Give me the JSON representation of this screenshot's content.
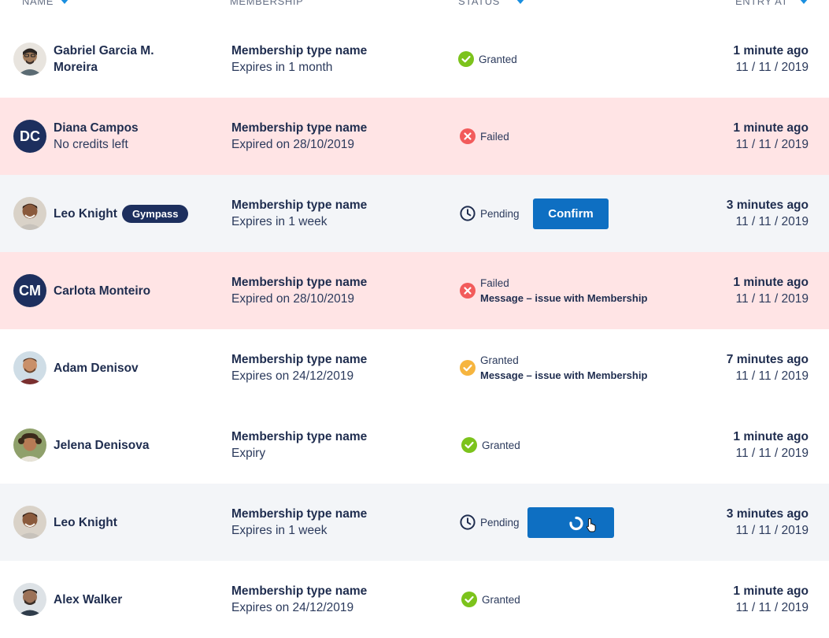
{
  "header": {
    "name": "NAME",
    "membership": "MEMBERSHIP",
    "status": "STATUS",
    "entry_at": "ENTRY AT"
  },
  "colors": {
    "granted": "#7cc31c",
    "failed": "#f25b5b",
    "warning": "#f6b53f",
    "primary_button": "#0e6fc2",
    "badge": "#1d2f5e",
    "failed_row_bg": "#ffe4e5",
    "alt_row_bg": "#f3f5f8"
  },
  "rows": [
    {
      "name_line1": "Gabriel Garcia M.",
      "name_line2": "Moreira",
      "membership": "Membership type name",
      "expiry": "Expires in 1 month",
      "status": "Granted",
      "entry": "1 minute ago",
      "date": "11 / 11 / 2019"
    },
    {
      "initials": "DC",
      "name": "Diana Campos",
      "sub": "No credits left",
      "membership": "Membership type name",
      "expiry": "Expired on 28/10/2019",
      "status": "Failed",
      "entry": "1 minute ago",
      "date": "11 / 11 / 2019"
    },
    {
      "name": "Leo Knight",
      "badge": "Gympass",
      "membership": "Membership type name",
      "expiry": "Expires in 1 week",
      "status": "Pending",
      "button": "Confirm",
      "entry": "3 minutes ago",
      "date": "11 / 11 / 2019"
    },
    {
      "initials": "CM",
      "name": "Carlota Monteiro",
      "membership": "Membership type name",
      "expiry": "Expired on 28/10/2019",
      "status": "Failed",
      "message": "Message – issue with Membership",
      "entry": "1 minute ago",
      "date": "11 / 11 / 2019"
    },
    {
      "name": "Adam Denisov",
      "membership": "Membership type name",
      "expiry": "Expires on 24/12/2019",
      "status": "Granted",
      "message": "Message – issue with Membership",
      "entry": "7 minutes ago",
      "date": "11 / 11 / 2019"
    },
    {
      "name": "Jelena Denisova",
      "membership": "Membership type name",
      "expiry": "Expiry",
      "status": "Granted",
      "entry": "1 minute ago",
      "date": "11 / 11 / 2019"
    },
    {
      "name": "Leo Knight",
      "membership": "Membership type name",
      "expiry": "Expires in 1 week",
      "status": "Pending",
      "entry": "3 minutes ago",
      "date": "11 / 11 / 2019"
    },
    {
      "name": "Alex Walker",
      "membership": "Membership type name",
      "expiry": "Expires on 24/12/2019",
      "status": "Granted",
      "entry": "1 minute ago",
      "date": "11 / 11 / 2019"
    }
  ]
}
